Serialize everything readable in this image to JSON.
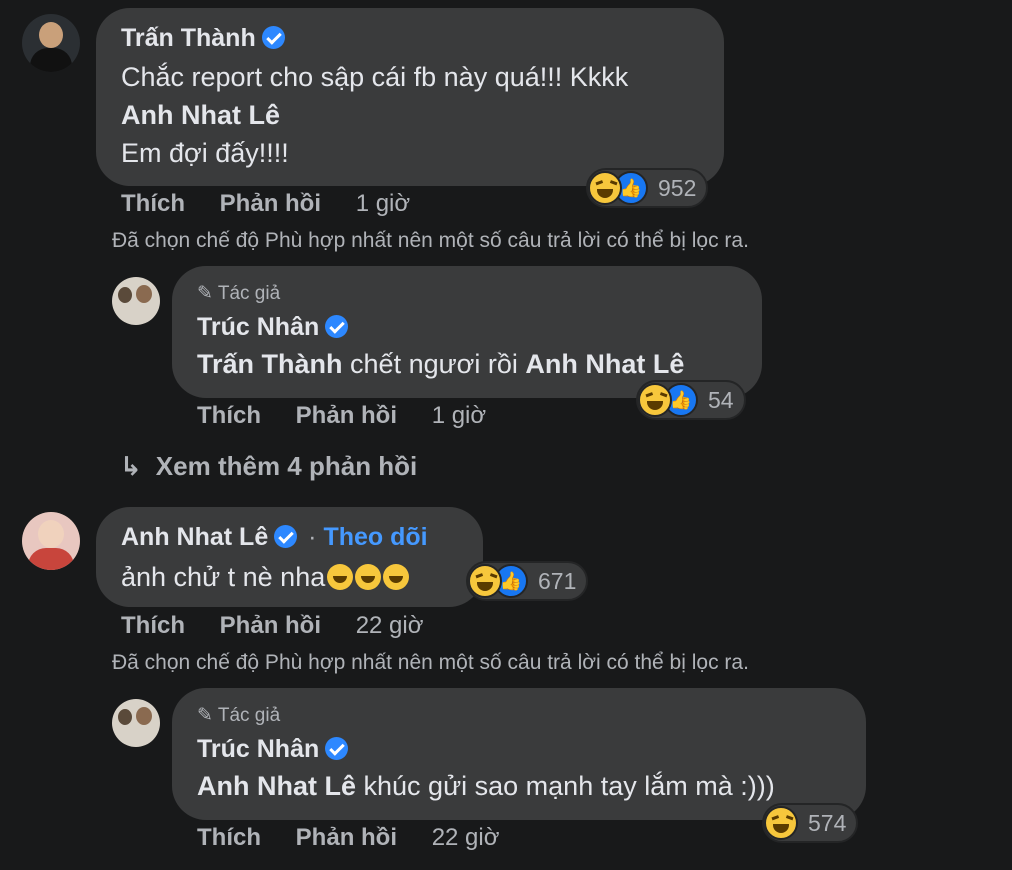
{
  "comments": [
    {
      "author": "Trấn Thành",
      "text_line1": "Chắc report cho sập cái fb này quá!!! Kkkk",
      "mention": "Anh Nhat Lê",
      "text_line3": "Em đợi đấy!!!!",
      "reaction_count": "952",
      "like_label": "Thích",
      "reply_label": "Phản hồi",
      "time": "1 giờ",
      "filter_note": "Đã chọn chế độ Phù hợp nhất nên một số câu trả lời có thể bị lọc ra."
    },
    {
      "badge": "Tác giả",
      "author": "Trúc Nhân",
      "mention1": "Trấn Thành",
      "text": "chết ngươi rồi",
      "mention2": "Anh Nhat Lê",
      "reaction_count": "54",
      "like_label": "Thích",
      "reply_label": "Phản hồi",
      "time": "1 giờ"
    },
    {
      "more_replies": "Xem thêm 4 phản hồi"
    },
    {
      "author": "Anh Nhat Lê",
      "separator": "·",
      "follow_label": "Theo dõi",
      "text": "ảnh chử t nè nha",
      "reaction_count": "671",
      "like_label": "Thích",
      "reply_label": "Phản hồi",
      "time": "22 giờ",
      "filter_note": "Đã chọn chế độ Phù hợp nhất nên một số câu trả lời có thể bị lọc ra."
    },
    {
      "badge": "Tác giả",
      "author": "Trúc Nhân",
      "mention": "Anh Nhat Lê",
      "text": "khúc gửi sao mạnh tay lắm mà :)))",
      "reaction_count": "574",
      "like_label": "Thích",
      "reply_label": "Phản hồi",
      "time": "22 giờ"
    }
  ],
  "icons": {
    "verified": "verified-badge-icon",
    "pencil": "pencil-icon",
    "reply_arrow": "reply-arrow-icon",
    "haha": "haha-reaction-icon",
    "like": "like-reaction-icon"
  }
}
